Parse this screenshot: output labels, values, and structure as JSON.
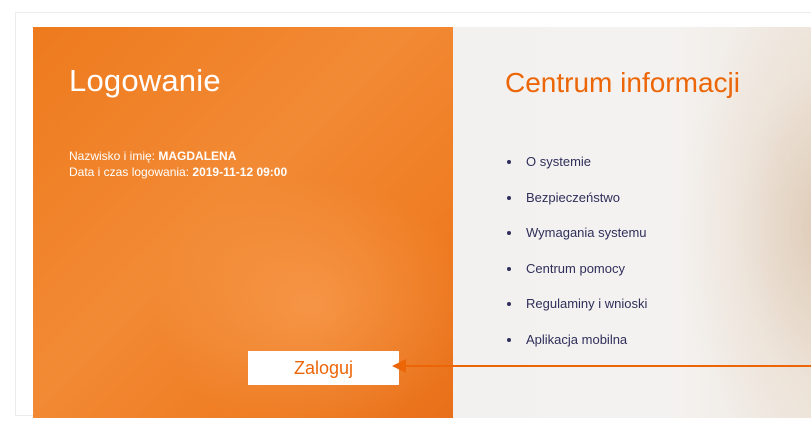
{
  "login": {
    "title": "Logowanie",
    "name_label": "Nazwisko i imię: ",
    "name_value": "MAGDALENA",
    "datetime_label": "Data i czas logowania: ",
    "datetime_value": "2019-11-12 09:00",
    "button_label": "Zaloguj"
  },
  "info": {
    "title": "Centrum informacji",
    "items": [
      {
        "label": "O systemie"
      },
      {
        "label": "Bezpieczeństwo"
      },
      {
        "label": "Wymagania systemu"
      },
      {
        "label": "Centrum pomocy"
      },
      {
        "label": "Regulaminy i wnioski"
      },
      {
        "label": "Aplikacja mobilna"
      }
    ]
  },
  "colors": {
    "accent": "#ec6608",
    "panel_orange": "#f0832a",
    "text_dark": "#2f2f5a"
  }
}
